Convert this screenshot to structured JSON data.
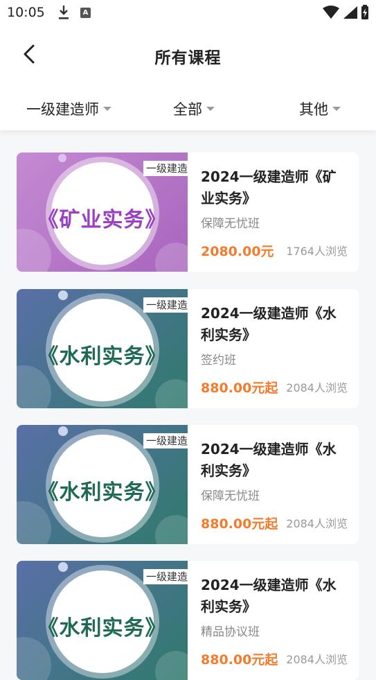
{
  "status_bar": {
    "time": "10:05",
    "a_icon_label": "A"
  },
  "nav": {
    "title": "所有课程"
  },
  "filters": [
    {
      "label": "一级建造师"
    },
    {
      "label": "全部"
    },
    {
      "label": "其他"
    }
  ],
  "thumb_tag": "一级建造",
  "courses": [
    {
      "thumb_text": "《矿业实务》",
      "title": "2024一级建造师《矿业实务》",
      "subtitle": "保障无忧班",
      "price": "2080.00元",
      "views": "1764人浏览",
      "theme": "purple"
    },
    {
      "thumb_text": "《水利实务》",
      "title": "2024一级建造师《水利实务》",
      "subtitle": "签约班",
      "price": "880.00元起",
      "views": "2084人浏览",
      "theme": "teal"
    },
    {
      "thumb_text": "《水利实务》",
      "title": "2024一级建造师《水利实务》",
      "subtitle": "保障无忧班",
      "price": "880.00元起",
      "views": "2084人浏览",
      "theme": "teal"
    },
    {
      "thumb_text": "《水利实务》",
      "title": "2024一级建造师《水利实务》",
      "subtitle": "精品协议班",
      "price": "880.00元起",
      "views": "2084人浏览",
      "theme": "teal"
    }
  ],
  "colors": {
    "accent_price": "#f57a2c",
    "purple_bg": "#b978c8",
    "teal_bg_start": "#4f6aa0",
    "teal_bg_end": "#2f7a6c"
  }
}
